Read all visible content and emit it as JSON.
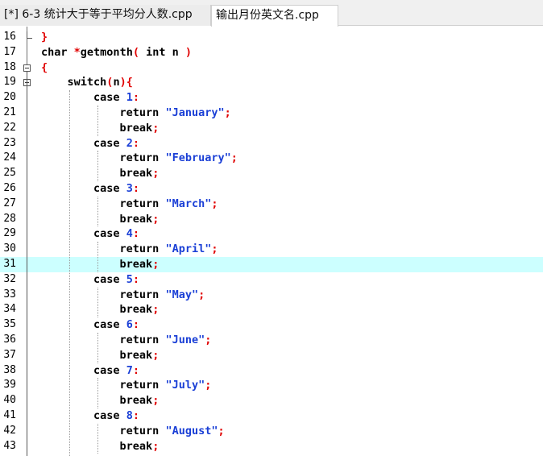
{
  "tabs": [
    {
      "label": "[*] 6-3 统计大于等于平均分人数.cpp",
      "active": false
    },
    {
      "label": "输出月份英文名.cpp",
      "active": true
    }
  ],
  "editor": {
    "highlight_line": 31,
    "colors": {
      "keyword": "#000000",
      "string": "#1a3fd6",
      "number": "#1a3fd6",
      "symbol": "#e00000",
      "highlight": "#ccffff"
    },
    "lines": [
      {
        "n": "16",
        "code": "}"
      },
      {
        "n": "17",
        "code": "char *getmonth( int n )"
      },
      {
        "n": "18",
        "code": "{"
      },
      {
        "n": "19",
        "code": "    switch(n){"
      },
      {
        "n": "20",
        "code": "        case 1:"
      },
      {
        "n": "21",
        "code": "            return \"January\";"
      },
      {
        "n": "22",
        "code": "            break;"
      },
      {
        "n": "23",
        "code": "        case 2:"
      },
      {
        "n": "24",
        "code": "            return \"February\";"
      },
      {
        "n": "25",
        "code": "            break;"
      },
      {
        "n": "26",
        "code": "        case 3:"
      },
      {
        "n": "27",
        "code": "            return \"March\";"
      },
      {
        "n": "28",
        "code": "            break;"
      },
      {
        "n": "29",
        "code": "        case 4:"
      },
      {
        "n": "30",
        "code": "            return \"April\";"
      },
      {
        "n": "31",
        "code": "            break;"
      },
      {
        "n": "32",
        "code": "        case 5:"
      },
      {
        "n": "33",
        "code": "            return \"May\";"
      },
      {
        "n": "34",
        "code": "            break;"
      },
      {
        "n": "35",
        "code": "        case 6:"
      },
      {
        "n": "36",
        "code": "            return \"June\";"
      },
      {
        "n": "37",
        "code": "            break;"
      },
      {
        "n": "38",
        "code": "        case 7:"
      },
      {
        "n": "39",
        "code": "            return \"July\";"
      },
      {
        "n": "40",
        "code": "            break;"
      },
      {
        "n": "41",
        "code": "        case 8:"
      },
      {
        "n": "42",
        "code": "            return \"August\";"
      },
      {
        "n": "43",
        "code": "            break;"
      }
    ]
  }
}
